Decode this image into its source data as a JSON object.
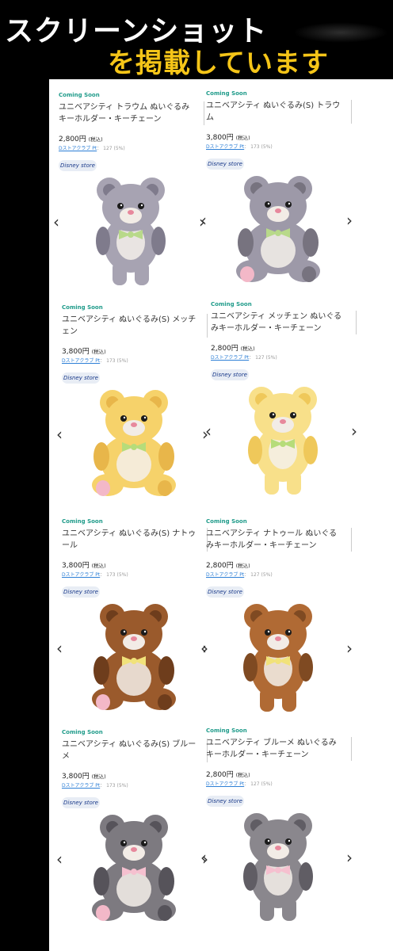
{
  "banner": {
    "line1": "スクリーンショット",
    "line2": "を掲載しています"
  },
  "common": {
    "coming_soon": "Coming Soon",
    "tax_label": "(税込)",
    "points_link": "Dストアクラブ Pt",
    "store_badge": "Disney store"
  },
  "products": [
    {
      "title": "ユニベアシティ トラウム ぬいぐるみキーホルダー・キーチェーン",
      "price": "2,800円",
      "points": "127 (5%)",
      "fur": "#a7a3b2",
      "fur_dark": "#7f7b8c",
      "accent": "#b8d98a",
      "kind": "keychain"
    },
    {
      "title": "ユニベアシティ ぬいぐるみ(S) トラウム",
      "price": "3,800円",
      "points": "173 (5%)",
      "fur": "#9d99a8",
      "fur_dark": "#77737f",
      "accent": "#b8d98a",
      "kind": "sitting"
    },
    {
      "title": "ユニベアシティ ぬいぐるみ(S) メッチェン",
      "price": "3,800円",
      "points": "173 (5%)",
      "fur": "#f6d26a",
      "fur_dark": "#e8b64a",
      "accent": "#b6dc7a",
      "kind": "sitting"
    },
    {
      "title": "ユニベアシティ メッチェン ぬいぐるみキーホルダー・キーチェーン",
      "price": "2,800円",
      "points": "127 (5%)",
      "fur": "#f8e08a",
      "fur_dark": "#efc85a",
      "accent": "#b6dc7a",
      "kind": "keychain"
    },
    {
      "title": "ユニベアシティ ぬいぐるみ(S) ナトゥール",
      "price": "3,800円",
      "points": "173 (5%)",
      "fur": "#9a5a2c",
      "fur_dark": "#6e3d1c",
      "accent": "#f1e27a",
      "kind": "sitting"
    },
    {
      "title": "ユニベアシティ ナトゥール ぬいぐるみキーホルダー・キーチェーン",
      "price": "2,800円",
      "points": "127 (5%)",
      "fur": "#b06a34",
      "fur_dark": "#7f4a22",
      "accent": "#f1e27a",
      "kind": "keychain"
    },
    {
      "title": "ユニベアシティ ぬいぐるみ(S) ブルーメ",
      "price": "3,800円",
      "points": "173 (5%)",
      "fur": "#7d7a80",
      "fur_dark": "#56535a",
      "accent": "#f5c0cf",
      "kind": "sitting"
    },
    {
      "title": "ユニベアシティ ブルーメ ぬいぐるみキーホルダー・キーチェーン",
      "price": "2,800円",
      "points": "127 (5%)",
      "fur": "#8a878d",
      "fur_dark": "#605d64",
      "accent": "#f5c0cf",
      "kind": "keychain"
    }
  ],
  "icons": {
    "prev": "chevron-left-icon",
    "next": "chevron-right-icon"
  }
}
